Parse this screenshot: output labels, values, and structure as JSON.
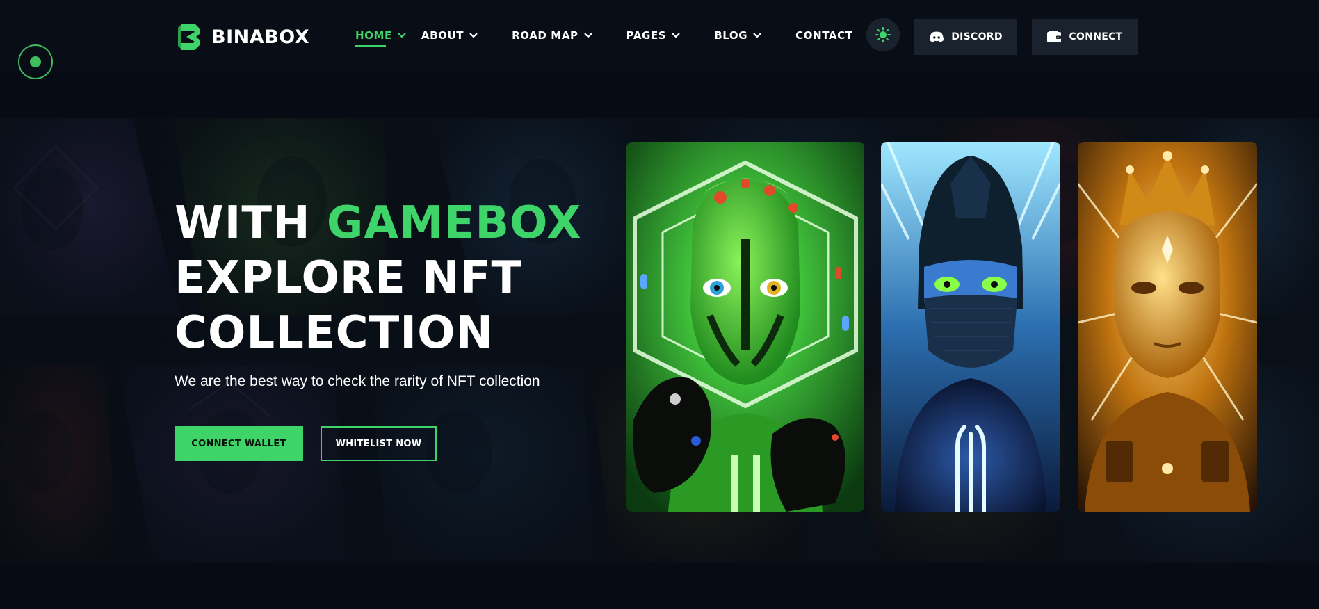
{
  "brand": {
    "name": "BINABOX"
  },
  "nav": {
    "items": [
      {
        "label": "HOME",
        "dropdown": true,
        "active": true
      },
      {
        "label": "ABOUT",
        "dropdown": true
      },
      {
        "label": "ROAD MAP",
        "dropdown": true
      },
      {
        "label": "PAGES",
        "dropdown": true
      },
      {
        "label": "BLOG",
        "dropdown": true
      },
      {
        "label": "CONTACT",
        "dropdown": false
      }
    ]
  },
  "header_actions": {
    "theme_toggle_icon": "sun-icon",
    "discord_label": "DISCORD",
    "discord_icon": "discord-icon",
    "connect_label": "CONNECT",
    "connect_icon": "wallet-icon"
  },
  "hero": {
    "title_line1_prefix": "WITH ",
    "title_line1_accent": "GAMEBOX",
    "title_line2": "EXPLORE NFT",
    "title_line3": "COLLECTION",
    "subtitle": "We are the best way to check the rarity of NFT collection",
    "primary_button": "CONNECT WALLET",
    "secondary_button": "WHITELIST NOW"
  },
  "cards": [
    {
      "name": "green-alien-nft",
      "theme": "green"
    },
    {
      "name": "blue-masked-nft",
      "theme": "blue"
    },
    {
      "name": "gold-crowned-nft",
      "theme": "gold"
    }
  ],
  "colors": {
    "background": "#070c14",
    "accent": "#3fd46a",
    "button_dark": "#1a222d",
    "text": "#ffffff"
  }
}
